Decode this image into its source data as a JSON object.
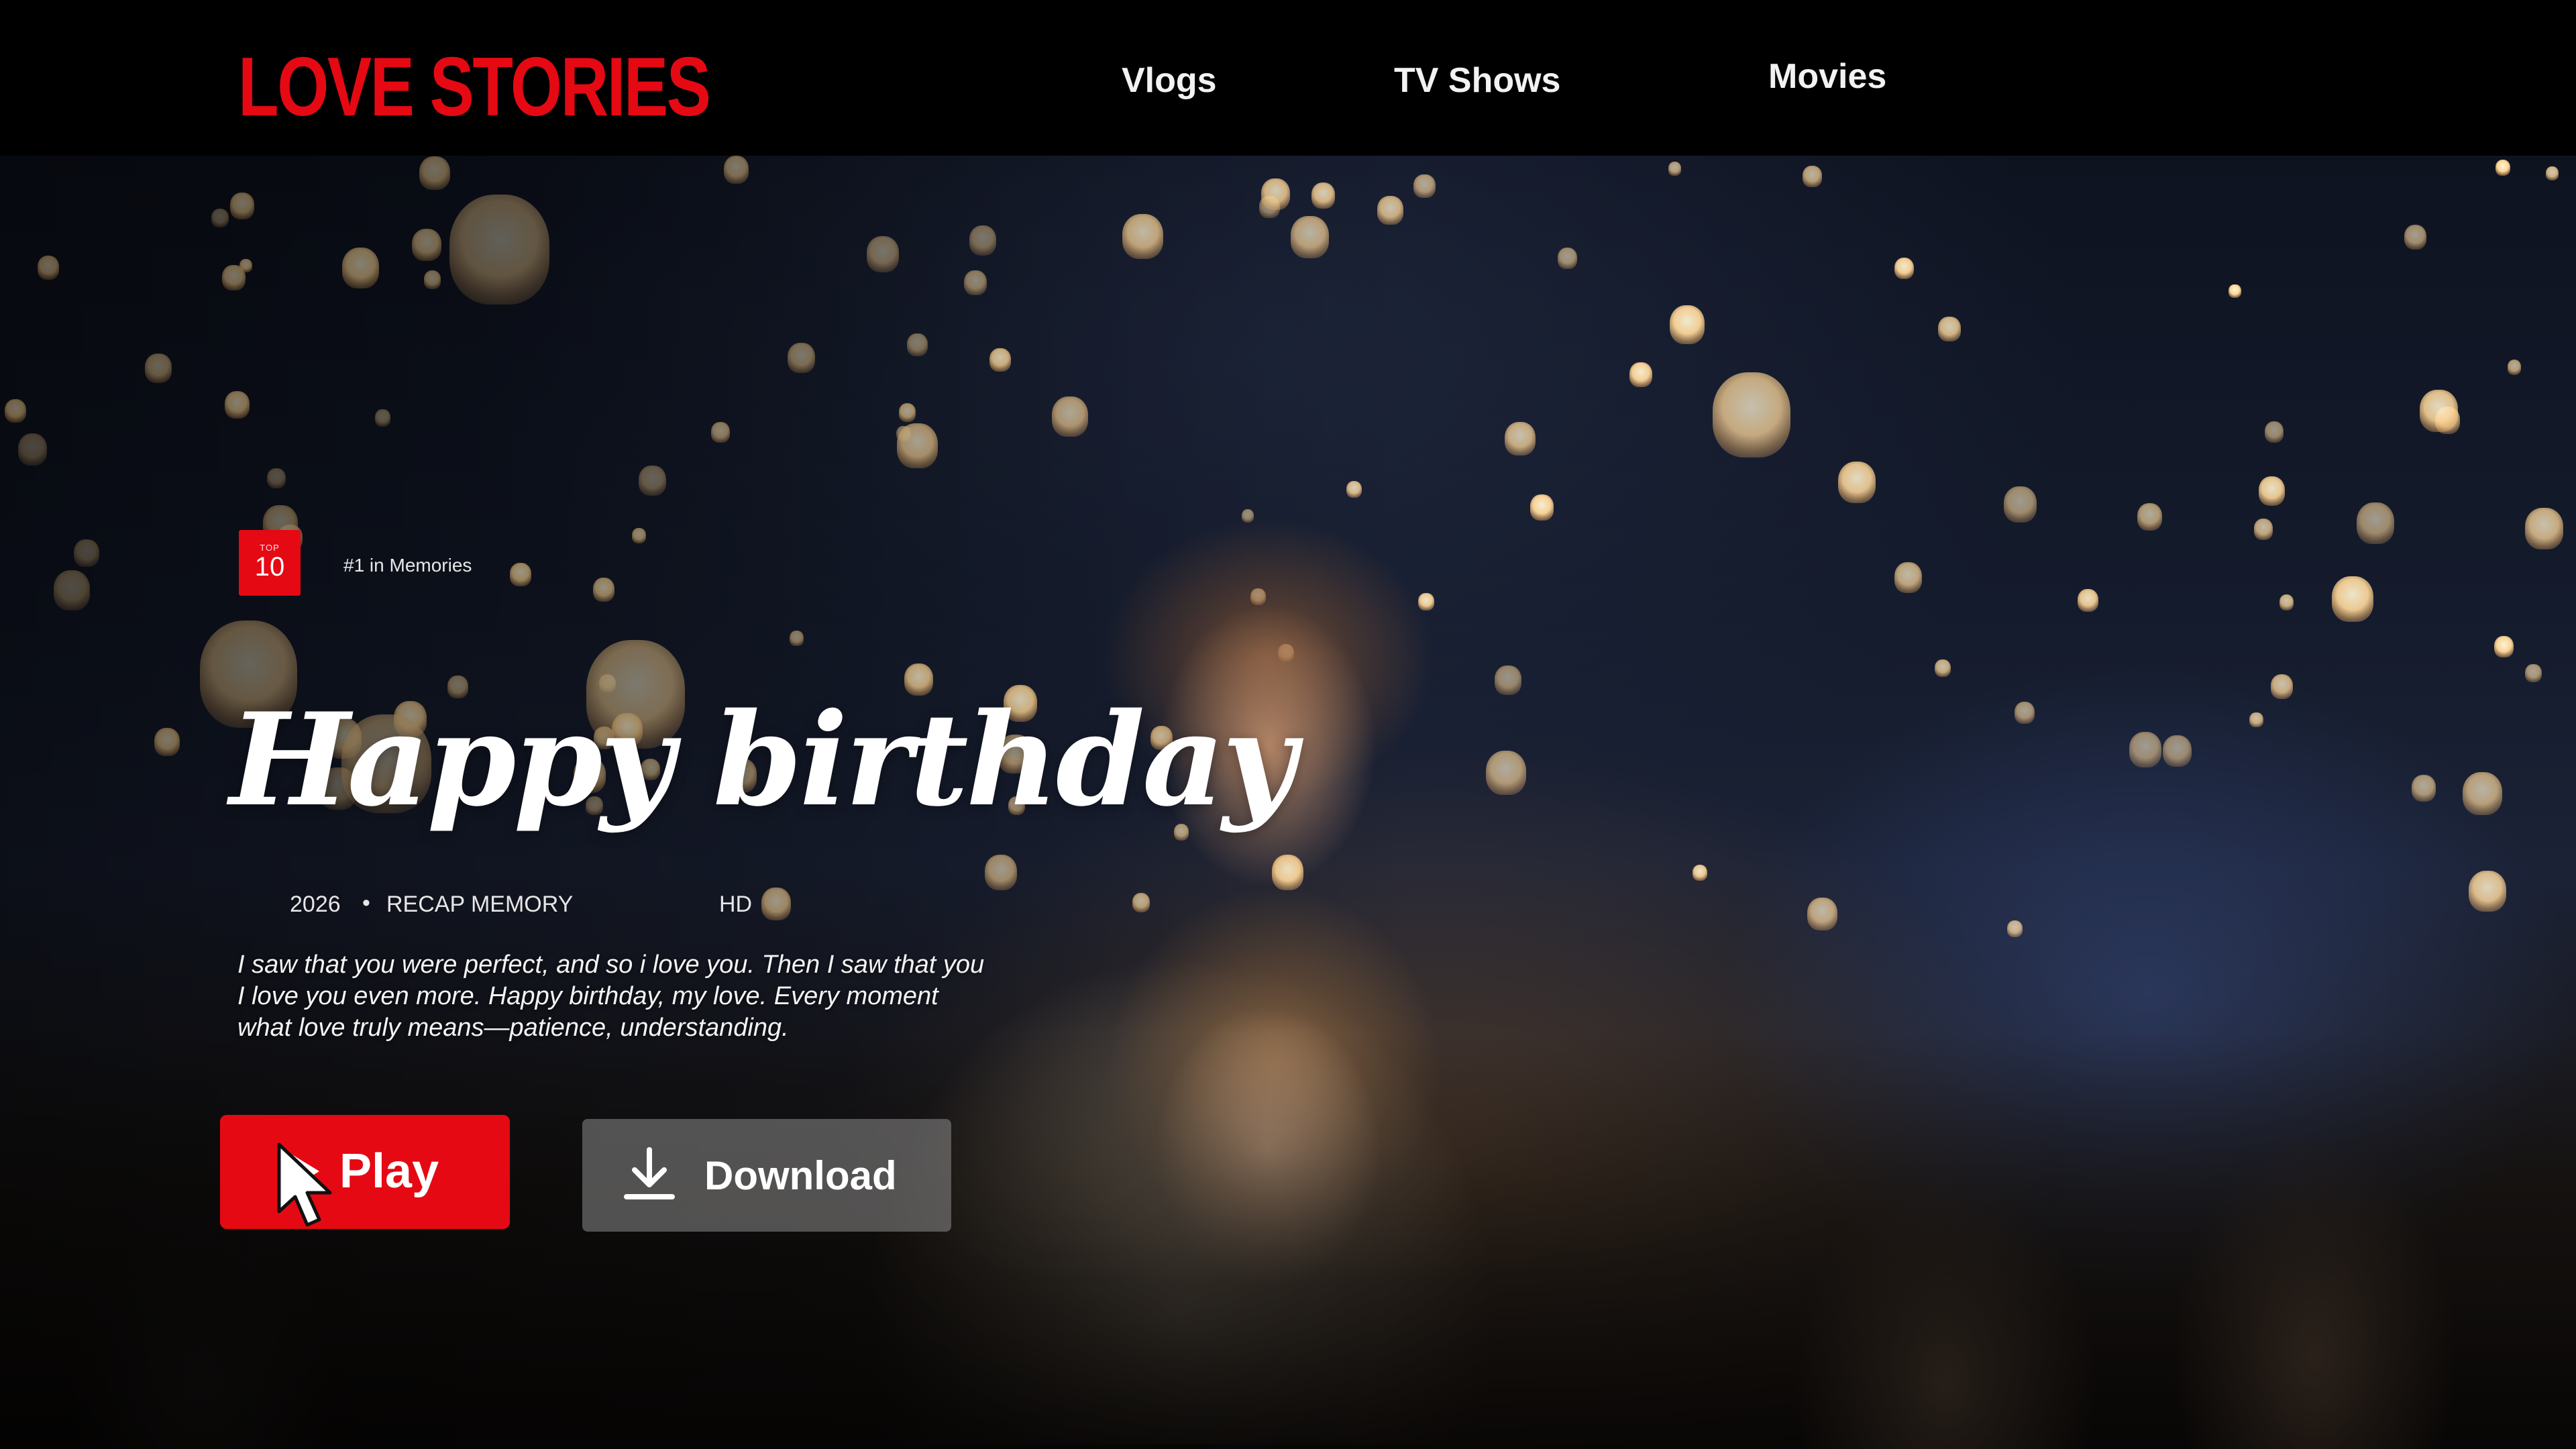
{
  "header": {
    "brand": "LOVE STORIES",
    "nav": [
      {
        "label": "Vlogs"
      },
      {
        "label": "TV Shows"
      },
      {
        "label": "Movies"
      }
    ]
  },
  "hero": {
    "badge": {
      "small": "TOP",
      "number": "10",
      "rank_text": "#1 in Memories"
    },
    "title": "Happy birthday",
    "meta": {
      "year": "2026",
      "separator": "•",
      "genre": "RECAP MEMORY",
      "quality": "HD"
    },
    "description": [
      "I saw that you were perfect, and so i love you. Then I saw that you",
      "I love you even more. Happy birthday, my love. Every moment",
      "what love truly means—patience, understanding."
    ],
    "buttons": {
      "play_label": "Play",
      "download_label": "Download"
    }
  },
  "colors": {
    "brand": "#e50914",
    "nav_background": "#000000",
    "download_button": "#8c8c8c"
  },
  "icons": {
    "play": "play-icon",
    "download": "download-icon",
    "cursor": "mouse-cursor-icon"
  }
}
